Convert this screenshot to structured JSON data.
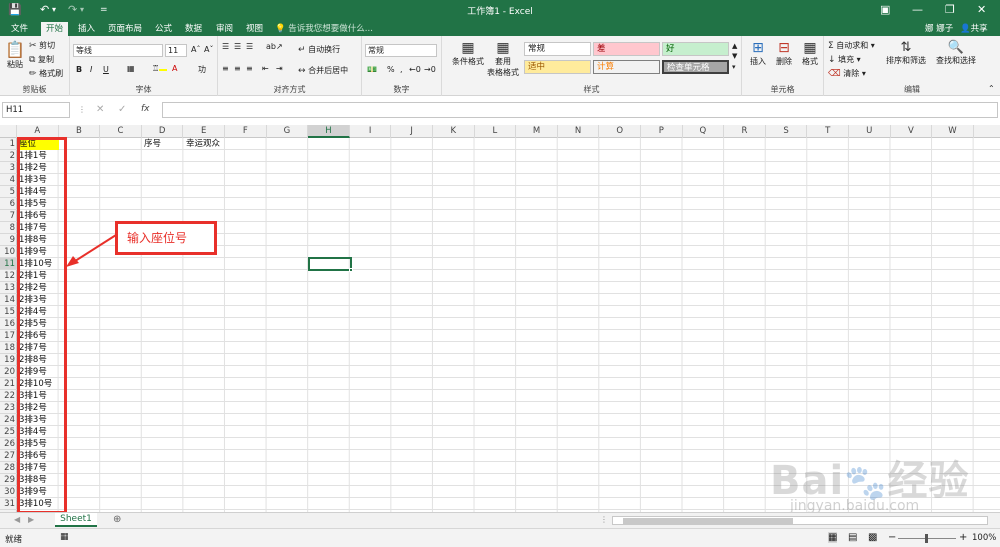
{
  "window": {
    "title": "工作簿1 - Excel",
    "qat_dropdown": "="
  },
  "tabs": [
    "文件",
    "开始",
    "插入",
    "页面布局",
    "公式",
    "数据",
    "审阅",
    "视图"
  ],
  "tell_me": "告诉我您想要做什么...",
  "user": "娜 娜子",
  "share": "共享",
  "clipboard": {
    "paste": "粘贴",
    "cut": "剪切",
    "copy": "复制",
    "format_painter": "格式刷",
    "label": "剪贴板"
  },
  "font": {
    "name": "等线",
    "size": "11",
    "label": "字体"
  },
  "alignment": {
    "wrap": "自动换行",
    "merge": "合并后居中",
    "label": "对齐方式"
  },
  "number": {
    "format": "常规",
    "label": "数字"
  },
  "styles": {
    "conditional": "条件格式",
    "table1": "套用",
    "table2": "表格格式",
    "normal": "常规",
    "bad": "差",
    "good": "好",
    "neutral": "适中",
    "calc": "计算",
    "check": "检查单元格",
    "label": "样式"
  },
  "cells_group": {
    "insert": "插入",
    "delete": "删除",
    "format": "格式",
    "label": "单元格"
  },
  "editing": {
    "autosum": "自动求和",
    "fill": "填充",
    "clear": "清除",
    "sort": "排序和筛选",
    "find": "查找和选择",
    "label": "编辑"
  },
  "formula_bar": {
    "name_box": "H11",
    "fx": "fx",
    "content": ""
  },
  "columns": [
    "A",
    "B",
    "C",
    "D",
    "E",
    "F",
    "G",
    "H",
    "I",
    "J",
    "K",
    "L",
    "M",
    "N",
    "O",
    "P",
    "Q",
    "R",
    "S",
    "T",
    "U",
    "V",
    "W"
  ],
  "rows": [
    "1",
    "2",
    "3",
    "4",
    "5",
    "6",
    "7",
    "8",
    "9",
    "10",
    "11",
    "12",
    "13",
    "14",
    "15",
    "16",
    "17",
    "18",
    "19",
    "20",
    "21",
    "22",
    "23",
    "24",
    "25",
    "26",
    "27",
    "28",
    "29",
    "30",
    "31"
  ],
  "cells": {
    "A": [
      "座位",
      "1排1号",
      "1排2号",
      "1排3号",
      "1排4号",
      "1排5号",
      "1排6号",
      "1排7号",
      "1排8号",
      "1排9号",
      "1排10号",
      "2排1号",
      "2排2号",
      "2排3号",
      "2排4号",
      "2排5号",
      "2排6号",
      "2排7号",
      "2排8号",
      "2排9号",
      "2排10号",
      "3排1号",
      "3排2号",
      "3排3号",
      "3排4号",
      "3排5号",
      "3排6号",
      "3排7号",
      "3排8号",
      "3排9号",
      "3排10号"
    ],
    "D1": "序号",
    "E1": "幸运观众"
  },
  "annotation": "输入座位号",
  "sheet_tab": "Sheet1",
  "status": {
    "ready": "就绪",
    "zoom": "100%"
  },
  "watermark": {
    "brand": "Bai",
    "brand2": "经验",
    "url": "jingyan.baidu.com"
  },
  "colors": {
    "excel_green": "#217346",
    "highlight_yellow": "#ffff00",
    "annotation_red": "#e8302a"
  }
}
